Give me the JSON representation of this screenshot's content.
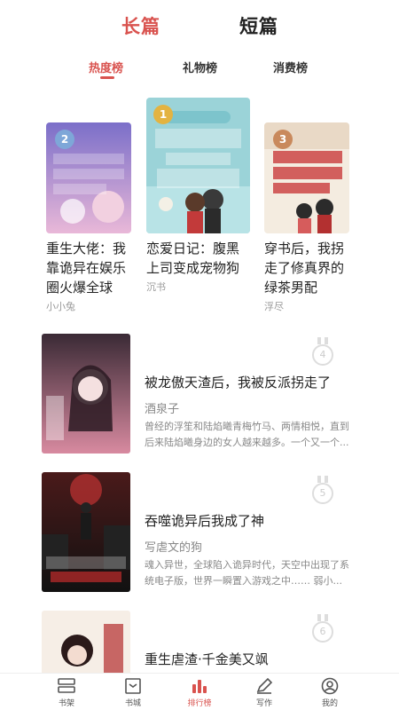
{
  "top_tabs": {
    "long": "长篇",
    "short": "短篇"
  },
  "sub_tabs": {
    "hot": "热度榜",
    "gift": "礼物榜",
    "spend": "消费榜"
  },
  "top_books": [
    {
      "rank": "2",
      "title": "重生大佬：我靠诡异在娱乐圈火爆全球",
      "author": "小小兔",
      "cover_text": "我靠诡异在娱乐圈爆全球"
    },
    {
      "rank": "1",
      "title": "恋爱日记：腹黑上司变成宠物狗",
      "author": "沉书",
      "cover_text": "恋爱日记 腹黑上司 变成 宠物狗"
    },
    {
      "rank": "3",
      "title": "穿书后，我拐走了修真界的绿茶男配",
      "author": "浮尽",
      "cover_text": "穿书后 我拐走了修真界的绿茶男配"
    }
  ],
  "list_books": [
    {
      "rank": "4",
      "title": "被龙傲天渣后，我被反派拐走了",
      "author": "酒泉子",
      "desc": "曾经的浮笙和陆焰曦青梅竹马、两情相悦，直到后来陆焰曦身边的女人越来越多。一个又一个..."
    },
    {
      "rank": "5",
      "title": "吞噬诡异后我成了神",
      "author": "写虐文的狗",
      "desc": "魂入异世，全球陷入诡异时代，天空中出现了系统电子版，世界一瞬置入游戏之中……  弱小..."
    },
    {
      "rank": "6",
      "title": "重生虐渣·千金美又飒",
      "author": "",
      "desc": ""
    }
  ],
  "nav": {
    "shelf": "书架",
    "store": "书城",
    "rank": "排行榜",
    "write": "写作",
    "mine": "我的"
  },
  "colors": {
    "accent": "#d9534f",
    "muted": "#999999"
  }
}
